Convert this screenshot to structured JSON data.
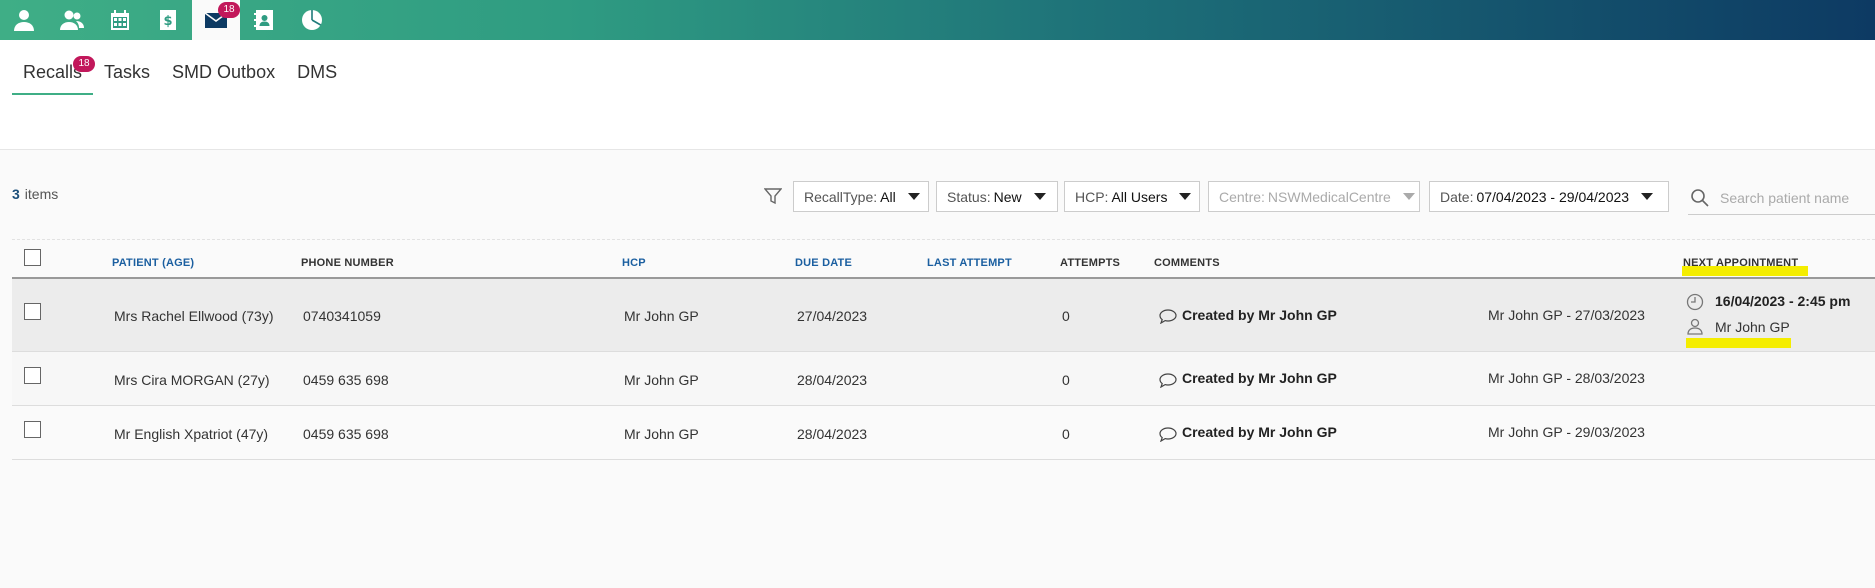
{
  "nav": {
    "badge_mail": "18",
    "items": [
      "person-icon",
      "people-icon",
      "calendar-icon",
      "billing-icon",
      "mail-icon",
      "contacts-icon",
      "reports-icon"
    ]
  },
  "subtabs": [
    {
      "label": "Recalls",
      "badge": "18",
      "active": true
    },
    {
      "label": "Tasks"
    },
    {
      "label": "SMD Outbox"
    },
    {
      "label": "DMS"
    }
  ],
  "toolbar": {
    "items_count": "3",
    "items_label": "items",
    "recall_type_label": "RecallType:",
    "recall_type_value": "All",
    "status_label": "Status:",
    "status_value": "New",
    "hcp_label": "HCP:",
    "hcp_value": "All Users",
    "centre_label": "Centre:",
    "centre_value": "NSWMedicalCentre",
    "date_label": "Date:",
    "date_value": "07/04/2023 - 29/04/2023",
    "search_placeholder": "Search patient name"
  },
  "table": {
    "headers": {
      "patient": "PATIENT (AGE)",
      "phone": "PHONE NUMBER",
      "hcp": "HCP",
      "due_date": "DUE DATE",
      "last_attempt": "LAST ATTEMPT",
      "attempts": "ATTEMPTS",
      "comments": "COMMENTS",
      "next_appointment": "NEXT APPOINTMENT"
    },
    "rows": [
      {
        "patient": "Mrs Rachel Ellwood (73y)",
        "phone": "0740341059",
        "hcp": "Mr John GP",
        "due_date": "27/04/2023",
        "attempts": "0",
        "comment": "Created by Mr John GP",
        "created": "Mr John GP - 27/03/2023",
        "appt_time": "16/04/2023 - 2:45 pm",
        "appt_hcp": "Mr John GP"
      },
      {
        "patient": "Mrs Cira MORGAN (27y)",
        "phone": "0459 635 698",
        "hcp": "Mr John GP",
        "due_date": "28/04/2023",
        "attempts": "0",
        "comment": "Created by Mr John GP",
        "created": "Mr John GP - 28/03/2023"
      },
      {
        "patient": "Mr English Xpatriot (47y)",
        "phone": "0459 635 698",
        "hcp": "Mr John GP",
        "due_date": "28/04/2023",
        "attempts": "0",
        "comment": "Created by Mr John GP",
        "created": "Mr John GP - 29/03/2023"
      }
    ]
  },
  "colors": {
    "highlight": "#f4ed00",
    "badge": "#c2185b",
    "accent_green": "#3fae86",
    "nav_dark": "#0d3a63"
  }
}
